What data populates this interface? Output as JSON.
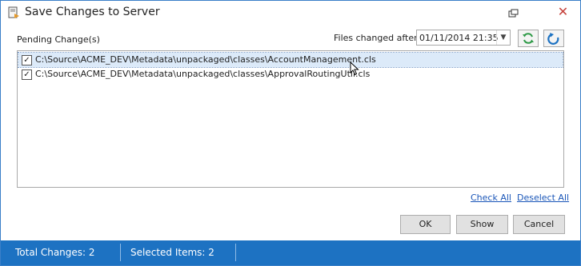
{
  "window": {
    "title": "Save Changes to Server"
  },
  "pending": {
    "label": "Pending Change(s)"
  },
  "filter": {
    "label": "Files changed after:",
    "date_value": "01/11/2014 21:35"
  },
  "toolbar": {
    "refresh_icon": "refresh-icon",
    "undo_icon": "undo-icon",
    "refresh_color": "#2e9a47",
    "undo_color": "#1d72c2"
  },
  "files": [
    {
      "path": "C:\\Source\\ACME_DEV\\Metadata\\unpackaged\\classes\\AccountManagement.cls",
      "checked": true,
      "selected": true
    },
    {
      "path": "C:\\Source\\ACME_DEV\\Metadata\\unpackaged\\classes\\ApprovalRoutingUtil.cls",
      "checked": true,
      "selected": false
    }
  ],
  "links": {
    "check_all": "Check All",
    "deselect_all": "Deselect All"
  },
  "buttons": {
    "ok": "OK",
    "show": "Show",
    "cancel": "Cancel"
  },
  "status": {
    "total": "Total Changes: 2",
    "selected": "Selected Items: 2",
    "bar_color": "#1d72c2"
  }
}
